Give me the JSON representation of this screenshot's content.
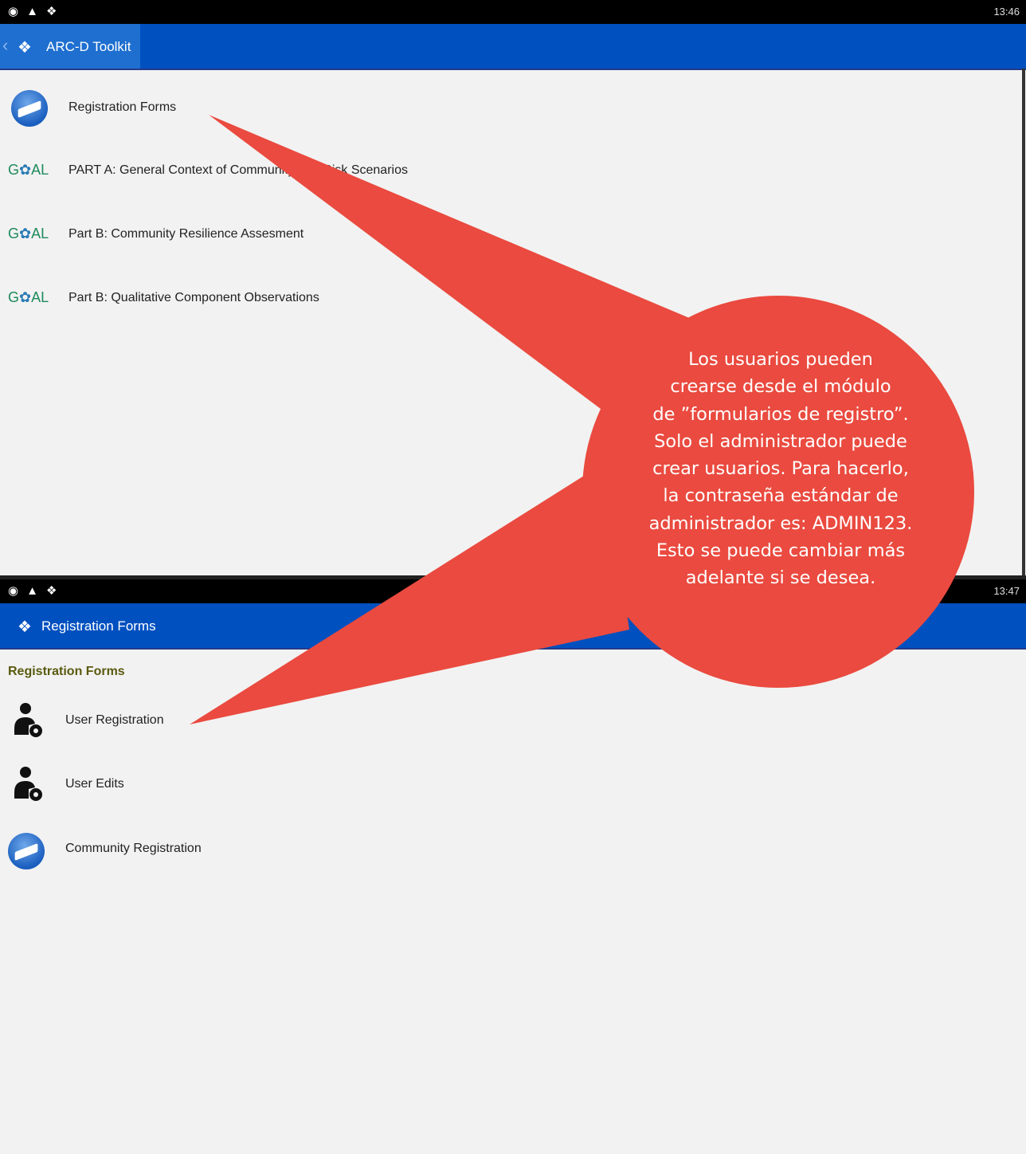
{
  "top": {
    "status_time": "13:46",
    "status_icons": [
      "location-icon",
      "usb-icon",
      "app-icon"
    ],
    "appbar_title": "ARC-D Toolkit",
    "items": [
      {
        "label": "Registration Forms",
        "icon": "registration-logo-icon"
      },
      {
        "label": "PART A: General Context of Community and Risk Scenarios",
        "icon": "goal-logo-icon"
      },
      {
        "label": "Part B: Community Resilience Assesment",
        "icon": "goal-logo-icon"
      },
      {
        "label": "Part B: Qualitative Component Observations",
        "icon": "goal-logo-icon"
      }
    ],
    "goal_text": "GOAL"
  },
  "bottom": {
    "status_time": "13:47",
    "appbar_title": "Registration Forms",
    "section_title": "Registration Forms",
    "items": [
      {
        "label": "User Registration",
        "icon": "user-gear-icon"
      },
      {
        "label": "User Edits",
        "icon": "user-gear-icon"
      },
      {
        "label": "Community Registration",
        "icon": "registration-logo-icon"
      }
    ]
  },
  "callout": {
    "color": "#ea4a3f",
    "lines": [
      "Los usuarios pueden",
      "crearse desde el módulo",
      "de ”formularios de registro”.",
      "Solo el administrador puede",
      "crear usuarios. Para hacerlo,",
      "la contraseña estándar de",
      "administrador es: ADMIN123.",
      "Esto se puede cambiar más",
      "adelante si se desea."
    ]
  }
}
